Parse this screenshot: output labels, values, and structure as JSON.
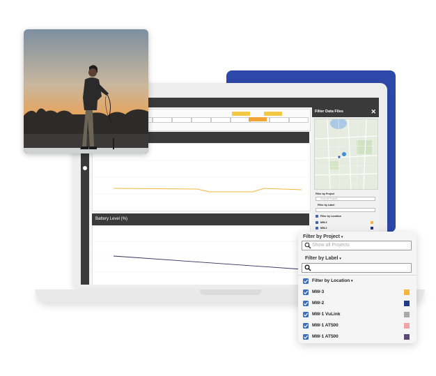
{
  "dashboard": {
    "battery_panel_title": "Battery Level (%)"
  },
  "side_panel": {
    "title": "Filter Data Files",
    "close_glyph": "✕",
    "project_label": "Filter by Project",
    "project_placeholder": "Show all Projects",
    "label_label": "Filter by Label",
    "location_label": "Filter by Location",
    "items": [
      {
        "name": "MW-3",
        "color": "#f2b63a"
      },
      {
        "name": "MW-2",
        "color": "#203a87"
      }
    ]
  },
  "filter_popup": {
    "project_label": "Filter by Project",
    "project_placeholder": "Show all Projects",
    "label_label": "Filter by Label",
    "label_value": "",
    "location_label": "Filter by Location",
    "caret": "▾",
    "locations": [
      {
        "name": "MW-3",
        "checked": true,
        "color": "#f2b63a"
      },
      {
        "name": "MW-2",
        "checked": true,
        "color": "#203a87"
      },
      {
        "name": "MW-1 VuLink",
        "checked": true,
        "color": "#a8a8a8"
      },
      {
        "name": "MW-1 AT500",
        "checked": true,
        "color": "#f0a3a3"
      },
      {
        "name": "MW-1 AT500",
        "checked": true,
        "color": "#5b4a78"
      }
    ]
  },
  "colors": {
    "accent_blue": "#2d48a8",
    "check_blue": "#3d6fba",
    "chart_line_orange": "#f2b63a",
    "chart_line_navy": "#2a2f5a"
  }
}
